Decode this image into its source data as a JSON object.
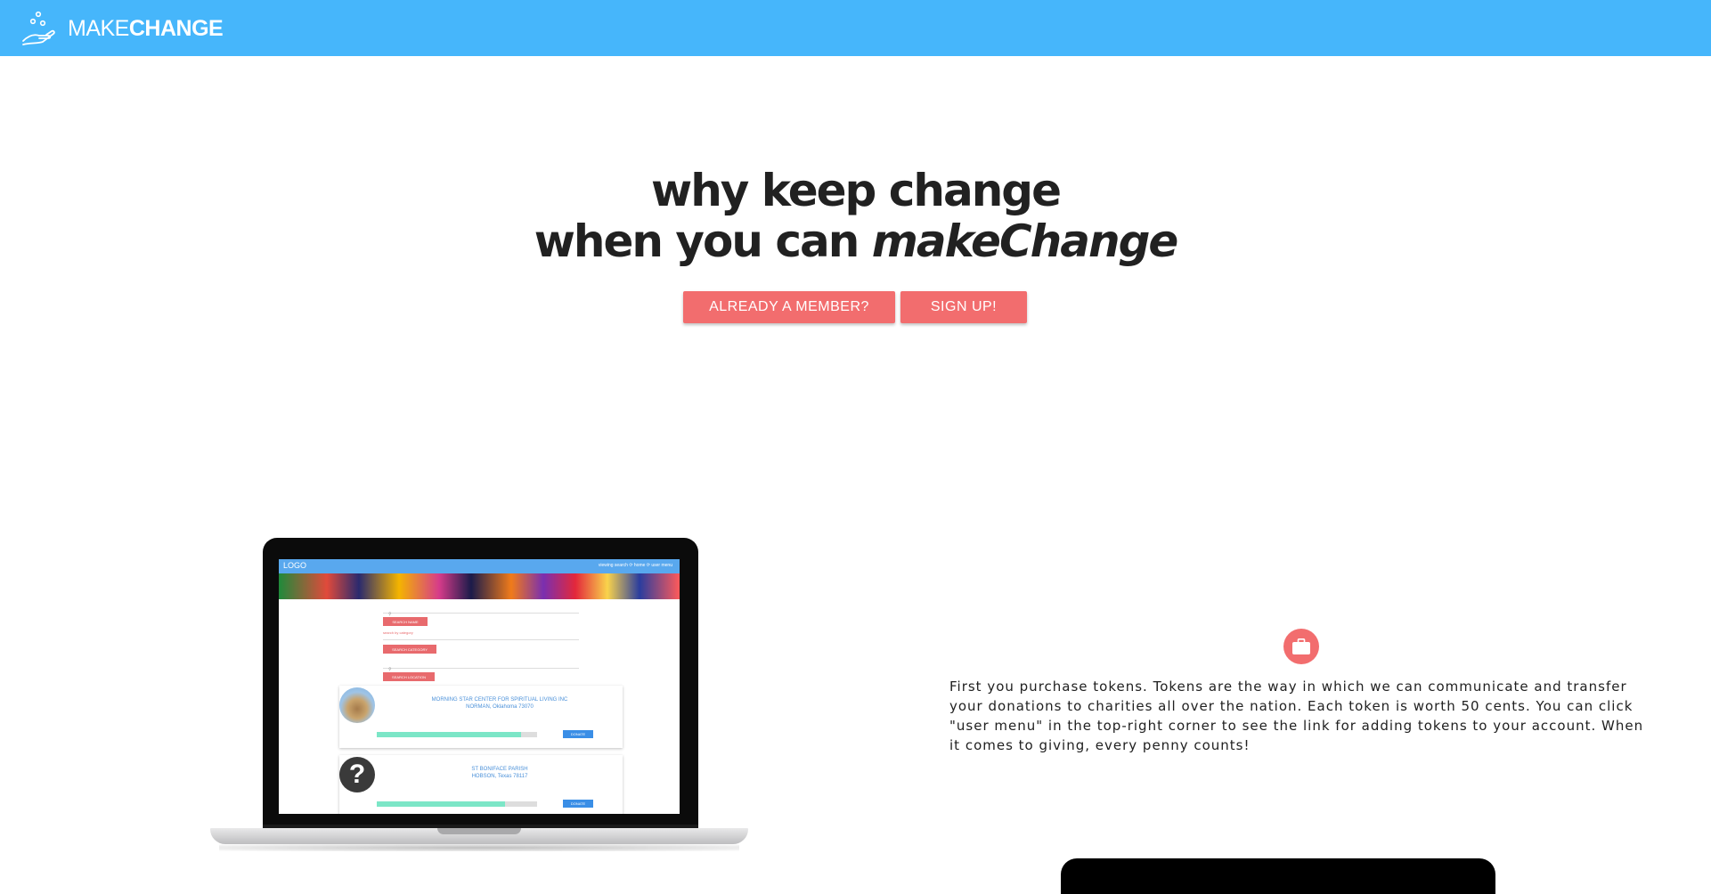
{
  "navbar": {
    "brand_prefix": "MAKE",
    "brand_suffix": "CHANGE",
    "background": "#46b6fb"
  },
  "hero": {
    "line1": "why keep change",
    "line2_prefix": "when you can ",
    "line2_emphasis": "makeChange"
  },
  "buttons": {
    "member_label": "ALREADY A MEMBER?",
    "signup_label": "SIGN UP!",
    "color": "#f26d6e"
  },
  "laptop_screen": {
    "logo": "LOGO",
    "nav_links": "viewing search  ⟳  home  ⟳  user menu",
    "search_buttons": [
      "SEARCH NAME",
      "SEARCH CATEGORY",
      "SEARCH LOCATION"
    ],
    "select_placeholder": "search by category",
    "cards": [
      {
        "name": "MORNING STAR CENTER FOR SPIRITUAL LIVING INC",
        "location": "NORMAN, Oklahoma 73070",
        "progress": 0.9,
        "donate_label": "DONATE",
        "avatar": "church-photo"
      },
      {
        "name": "ST BONIFACE PARISH",
        "location": "HOBSON, Texas 78117",
        "progress": 0.8,
        "donate_label": "DONATE",
        "avatar": "question-mark"
      }
    ]
  },
  "info": {
    "icon": "briefcase-icon",
    "text": "First you purchase tokens. Tokens are the way in which we can communicate and transfer your donations to charities all over the nation. Each token is worth 50 cents. You can click \"user menu\" in the top-right corner to see the link for adding tokens to your account. When it comes to giving, every penny counts!"
  }
}
